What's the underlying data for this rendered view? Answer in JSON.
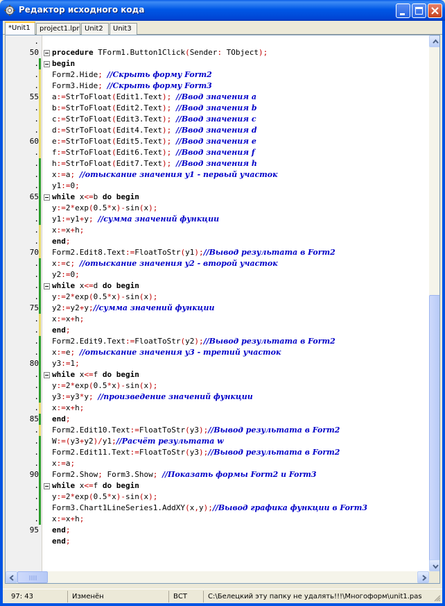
{
  "window": {
    "title": "Редактор исходного кода"
  },
  "tabs": [
    {
      "label": "*Unit1",
      "active": true
    },
    {
      "label": "project1.lpr",
      "active": false
    },
    {
      "label": "Unit2",
      "active": false
    },
    {
      "label": "Unit3",
      "active": false
    }
  ],
  "gutter": [
    {
      "mark": ".",
      "bar": ""
    },
    {
      "mark": "50",
      "bar": ""
    },
    {
      "mark": ".",
      "bar": "green"
    },
    {
      "mark": ".",
      "bar": "yellow"
    },
    {
      "mark": ".",
      "bar": "yellow"
    },
    {
      "mark": "55",
      "bar": "yellow"
    },
    {
      "mark": ".",
      "bar": "yellow"
    },
    {
      "mark": ".",
      "bar": "yellow"
    },
    {
      "mark": ".",
      "bar": "yellow"
    },
    {
      "mark": "60",
      "bar": "yellow"
    },
    {
      "mark": ".",
      "bar": "yellow"
    },
    {
      "mark": ".",
      "bar": "green"
    },
    {
      "mark": ".",
      "bar": "green"
    },
    {
      "mark": ".",
      "bar": "green"
    },
    {
      "mark": "65",
      "bar": "green"
    },
    {
      "mark": ".",
      "bar": "green"
    },
    {
      "mark": ".",
      "bar": "green"
    },
    {
      "mark": ".",
      "bar": "yellow"
    },
    {
      "mark": ".",
      "bar": "yellow"
    },
    {
      "mark": "70",
      "bar": "yellow"
    },
    {
      "mark": ".",
      "bar": "green"
    },
    {
      "mark": ".",
      "bar": "green"
    },
    {
      "mark": ".",
      "bar": "green"
    },
    {
      "mark": ".",
      "bar": "green"
    },
    {
      "mark": "75",
      "bar": "green"
    },
    {
      "mark": ".",
      "bar": "yellow"
    },
    {
      "mark": ".",
      "bar": "yellow"
    },
    {
      "mark": ".",
      "bar": "green"
    },
    {
      "mark": ".",
      "bar": "green"
    },
    {
      "mark": "80",
      "bar": "green"
    },
    {
      "mark": ".",
      "bar": "green"
    },
    {
      "mark": ".",
      "bar": "green"
    },
    {
      "mark": ".",
      "bar": "green"
    },
    {
      "mark": ".",
      "bar": "yellow"
    },
    {
      "mark": "85",
      "bar": "green"
    },
    {
      "mark": ".",
      "bar": "yellow"
    },
    {
      "mark": ".",
      "bar": "green"
    },
    {
      "mark": ".",
      "bar": "green"
    },
    {
      "mark": ".",
      "bar": "green"
    },
    {
      "mark": "90",
      "bar": "green"
    },
    {
      "mark": ".",
      "bar": "green"
    },
    {
      "mark": ".",
      "bar": "green"
    },
    {
      "mark": ".",
      "bar": "green"
    },
    {
      "mark": ".",
      "bar": "green"
    },
    {
      "mark": "95",
      "bar": ""
    }
  ],
  "code": [
    {
      "fold": false,
      "parts": []
    },
    {
      "fold": true,
      "parts": [
        [
          "kw",
          "procedure"
        ],
        [
          "id",
          " TForm1.Button1Click(Sender: TObject);"
        ]
      ]
    },
    {
      "fold": true,
      "parts": [
        [
          "kw",
          "begin"
        ]
      ]
    },
    {
      "fold": false,
      "parts": [
        [
          "id",
          "Form2.Hide; "
        ],
        [
          "cm",
          "//Скрыть форму Form2"
        ]
      ]
    },
    {
      "fold": false,
      "parts": [
        [
          "id",
          "Form3.Hide; "
        ],
        [
          "cm",
          "//Скрыть форму Form3"
        ]
      ]
    },
    {
      "fold": false,
      "parts": [
        [
          "id",
          "a:=StrToFloat(Edit1.Text); "
        ],
        [
          "cm",
          "//Ввод значения a"
        ]
      ]
    },
    {
      "fold": false,
      "parts": [
        [
          "id",
          "b:=StrToFloat(Edit2.Text); "
        ],
        [
          "cm",
          "//Ввод значения b"
        ]
      ]
    },
    {
      "fold": false,
      "parts": [
        [
          "id",
          "c:=StrToFloat(Edit3.Text); "
        ],
        [
          "cm",
          "//Ввод значения c"
        ]
      ]
    },
    {
      "fold": false,
      "parts": [
        [
          "id",
          "d:=StrToFloat(Edit4.Text); "
        ],
        [
          "cm",
          "//Ввод значения d"
        ]
      ]
    },
    {
      "fold": false,
      "parts": [
        [
          "id",
          "e:=StrToFloat(Edit5.Text); "
        ],
        [
          "cm",
          "//Ввод значения e"
        ]
      ]
    },
    {
      "fold": false,
      "parts": [
        [
          "id",
          "f:=StrToFloat(Edit6.Text); "
        ],
        [
          "cm",
          "//Ввод значения f"
        ]
      ]
    },
    {
      "fold": false,
      "parts": [
        [
          "id",
          "h:=StrToFloat(Edit7.Text); "
        ],
        [
          "cm",
          "//Ввод значения h"
        ]
      ]
    },
    {
      "fold": false,
      "parts": [
        [
          "id",
          "x:=a; "
        ],
        [
          "cm",
          "//отыскание значения y1 - первый участок"
        ]
      ]
    },
    {
      "fold": false,
      "parts": [
        [
          "id",
          "y1:=0;"
        ]
      ]
    },
    {
      "fold": true,
      "parts": [
        [
          "kw",
          "while"
        ],
        [
          "id",
          " x<=b "
        ],
        [
          "kw",
          "do begin"
        ]
      ]
    },
    {
      "fold": false,
      "parts": [
        [
          "id",
          "y:=2*exp(0.5*x)-sin(x);"
        ]
      ]
    },
    {
      "fold": false,
      "parts": [
        [
          "id",
          "y1:=y1+y; "
        ],
        [
          "cm",
          "//сумма значений функции"
        ]
      ]
    },
    {
      "fold": false,
      "parts": [
        [
          "id",
          "x:=x+h;"
        ]
      ]
    },
    {
      "fold": false,
      "parts": [
        [
          "kw",
          "end"
        ],
        [
          "id",
          ";"
        ]
      ]
    },
    {
      "fold": false,
      "parts": [
        [
          "id",
          "Form2.Edit8.Text:=FloatToStr(y1);"
        ],
        [
          "cm",
          "//Вывод результата в Form2"
        ]
      ]
    },
    {
      "fold": false,
      "parts": [
        [
          "id",
          "x:=c; "
        ],
        [
          "cm",
          "//отыскание значения y2 - второй участок"
        ]
      ]
    },
    {
      "fold": false,
      "parts": [
        [
          "id",
          "y2:=0;"
        ]
      ]
    },
    {
      "fold": true,
      "parts": [
        [
          "kw",
          "while"
        ],
        [
          "id",
          " x<=d "
        ],
        [
          "kw",
          "do begin"
        ]
      ]
    },
    {
      "fold": false,
      "parts": [
        [
          "id",
          "y:=2*exp(0.5*x)-sin(x);"
        ]
      ]
    },
    {
      "fold": false,
      "parts": [
        [
          "id",
          "y2:=y2+y;"
        ],
        [
          "cm",
          "//сумма значений функции"
        ]
      ]
    },
    {
      "fold": false,
      "parts": [
        [
          "id",
          "x:=x+h;"
        ]
      ]
    },
    {
      "fold": false,
      "parts": [
        [
          "kw",
          "end"
        ],
        [
          "id",
          ";"
        ]
      ]
    },
    {
      "fold": false,
      "parts": [
        [
          "id",
          "Form2.Edit9.Text:=FloatToStr(y2);"
        ],
        [
          "cm",
          "//Вывод результата в Form2"
        ]
      ]
    },
    {
      "fold": false,
      "parts": [
        [
          "id",
          "x:=e; "
        ],
        [
          "cm",
          "//отыскание значения y3 - третий участок"
        ]
      ]
    },
    {
      "fold": false,
      "parts": [
        [
          "id",
          "y3:=1;"
        ]
      ]
    },
    {
      "fold": true,
      "parts": [
        [
          "kw",
          "while"
        ],
        [
          "id",
          " x<=f "
        ],
        [
          "kw",
          "do begin"
        ]
      ]
    },
    {
      "fold": false,
      "parts": [
        [
          "id",
          "y:=2*exp(0.5*x)-sin(x);"
        ]
      ]
    },
    {
      "fold": false,
      "parts": [
        [
          "id",
          "y3:=y3*y; "
        ],
        [
          "cm",
          "//произведение значений функции"
        ]
      ]
    },
    {
      "fold": false,
      "parts": [
        [
          "id",
          "x:=x+h;"
        ]
      ]
    },
    {
      "fold": false,
      "parts": [
        [
          "kw",
          "end"
        ],
        [
          "id",
          ";"
        ]
      ]
    },
    {
      "fold": false,
      "parts": [
        [
          "id",
          "Form2.Edit10.Text:=FloatToStr(y3);"
        ],
        [
          "cm",
          "//Вывод результата в Form2"
        ]
      ]
    },
    {
      "fold": false,
      "parts": [
        [
          "id",
          "W:=(y3+y2)/y1;"
        ],
        [
          "cm",
          "//Расчёт результата w"
        ]
      ]
    },
    {
      "fold": false,
      "parts": [
        [
          "id",
          "Form2.Edit11.Text:=FloatToStr(y3);"
        ],
        [
          "cm",
          "//Вывод результата в Form2"
        ]
      ]
    },
    {
      "fold": false,
      "parts": [
        [
          "id",
          "x:=a;"
        ]
      ]
    },
    {
      "fold": false,
      "parts": [
        [
          "id",
          "Form2.Show; Form3.Show; "
        ],
        [
          "cm",
          "//Показать формы Form2 и Form3"
        ]
      ]
    },
    {
      "fold": true,
      "parts": [
        [
          "kw",
          "while"
        ],
        [
          "id",
          " x<=f "
        ],
        [
          "kw",
          "do begin"
        ]
      ]
    },
    {
      "fold": false,
      "parts": [
        [
          "id",
          "y:=2*exp(0.5*x)-sin(x);"
        ]
      ]
    },
    {
      "fold": false,
      "parts": [
        [
          "id",
          "Form3.Chart1LineSeries1.AddXY(x,y);"
        ],
        [
          "cm",
          "//Вывод графика функции в Form3"
        ]
      ]
    },
    {
      "fold": false,
      "parts": [
        [
          "id",
          "x:=x+h;"
        ]
      ]
    },
    {
      "fold": false,
      "parts": [
        [
          "kw",
          "end"
        ],
        [
          "id",
          ";"
        ]
      ]
    },
    {
      "fold": false,
      "parts": [
        [
          "kw",
          "end"
        ],
        [
          "id",
          ";"
        ]
      ]
    }
  ],
  "statusbar": {
    "cursor": "97: 43",
    "modified": "Изменён",
    "mode": "ВСТ",
    "path": "C:\\Белецкий эту папку не удалять!!!\\Многоформ\\unit1.pas"
  },
  "colors": {
    "keyword": "#000000",
    "symbol": "#c00000",
    "comment": "#0000c8",
    "changed_bar": "#2a9c2a",
    "saved_bar": "#e8d96a"
  },
  "icons": [
    "app-icon",
    "minimize-icon",
    "maximize-icon",
    "close-icon",
    "scroll-up-icon",
    "scroll-down-icon",
    "scroll-left-icon",
    "scroll-right-icon",
    "size-grip-icon"
  ]
}
